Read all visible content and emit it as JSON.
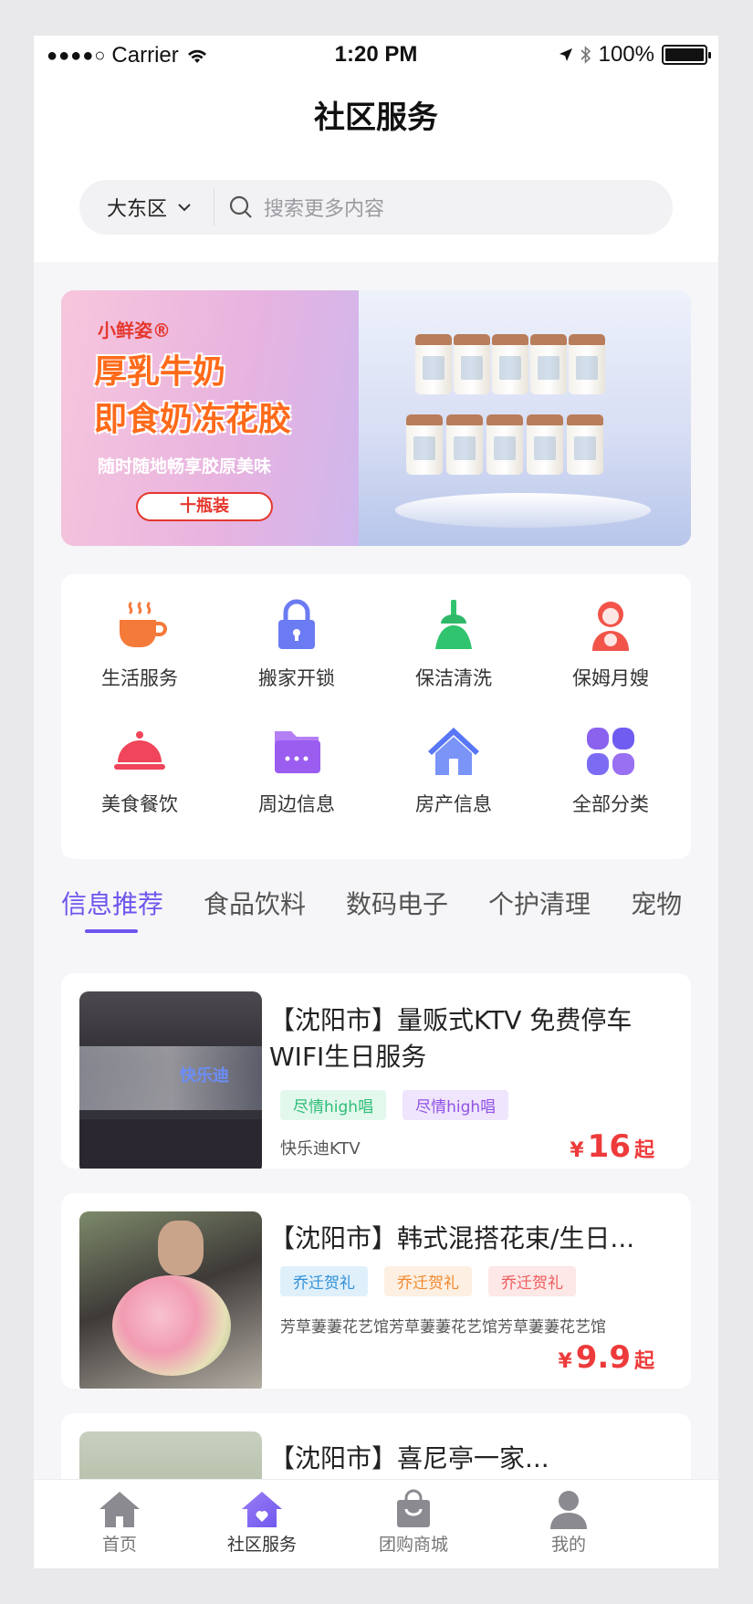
{
  "status_bar": {
    "carrier": "Carrier",
    "time": "1:20 PM",
    "battery": "100%",
    "battery_level": 1.0
  },
  "header": {
    "title": "社区服务"
  },
  "search": {
    "district": "大东区",
    "placeholder": "搜索更多内容"
  },
  "banner": {
    "brand": "小鲜姿®",
    "headline1": "厚乳牛奶",
    "headline2": "即食奶冻花胶",
    "subtitle": "随时随地畅享胶原美味",
    "button": "十瓶装"
  },
  "categories": [
    {
      "label": "生活服务",
      "icon": "coffee-cup-icon",
      "color": "#f47a3a"
    },
    {
      "label": "搬家开锁",
      "icon": "lock-icon",
      "color": "#6b7bf2"
    },
    {
      "label": "保洁清洗",
      "icon": "broom-icon",
      "color": "#31c46f"
    },
    {
      "label": "保姆月嫂",
      "icon": "nanny-icon",
      "color": "#f2544a"
    },
    {
      "label": "美食餐饮",
      "icon": "dish-cover-icon",
      "color": "#f0455a"
    },
    {
      "label": "周边信息",
      "icon": "folder-icon",
      "color": "#9a5df0"
    },
    {
      "label": "房产信息",
      "icon": "house-icon",
      "color": "#5876f5"
    },
    {
      "label": "全部分类",
      "icon": "grid-icon",
      "color": "#8a62ee"
    }
  ],
  "tabs": [
    "信息推荐",
    "食品饮料",
    "数码电子",
    "个护清理",
    "宠物"
  ],
  "listings": [
    {
      "title": "【沈阳市】量贩式KTV 免费停车WIFI生日服务",
      "tags": [
        {
          "text": "尽情high唱",
          "color": "#2ebd78",
          "bg": "#e3f8ec"
        },
        {
          "text": "尽情high唱",
          "color": "#9152e6",
          "bg": "#efe5fc"
        }
      ],
      "shop": "快乐迪KTV",
      "price_symbol": "¥",
      "price": "16",
      "price_suffix": "起",
      "thumb_text": "快乐迪"
    },
    {
      "title": "【沈阳市】韩式混搭花束/生日...",
      "tags": [
        {
          "text": "乔迁贺礼",
          "color": "#2f8fd6",
          "bg": "#dff0fb"
        },
        {
          "text": "乔迁贺礼",
          "color": "#f0882e",
          "bg": "#fdf0e2"
        },
        {
          "text": "乔迁贺礼",
          "color": "#ee5a5a",
          "bg": "#fde7e7"
        }
      ],
      "shop": "芳草萋萋花艺馆芳草萋萋花艺馆芳草萋萋花艺馆",
      "price_symbol": "¥",
      "price": "9.9",
      "price_suffix": "起"
    },
    {
      "title": "【沈阳市】喜尼亭一家...",
      "partial": true
    }
  ],
  "tabbar": [
    {
      "label": "首页",
      "icon": "home-icon",
      "active": false
    },
    {
      "label": "社区服务",
      "icon": "community-icon",
      "active": true
    },
    {
      "label": "团购商城",
      "icon": "shopping-bag-icon",
      "active": false
    },
    {
      "label": "我的",
      "icon": "user-icon",
      "active": false
    }
  ]
}
